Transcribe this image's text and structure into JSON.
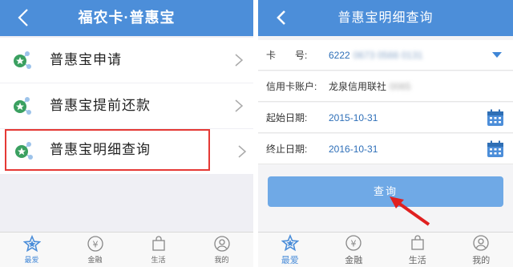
{
  "left": {
    "title": "福农卡·普惠宝",
    "menu": [
      {
        "label": "普惠宝申请"
      },
      {
        "label": "普惠宝提前还款"
      },
      {
        "label": "普惠宝明细查询"
      }
    ],
    "tabs": [
      {
        "label": "最爱",
        "icon": "star-icon"
      },
      {
        "label": "金融",
        "icon": "yen-coin-icon"
      },
      {
        "label": "生活",
        "icon": "shopping-bag-icon"
      },
      {
        "label": "我的",
        "icon": "user-icon"
      }
    ]
  },
  "right": {
    "title": "普惠宝明细查询",
    "form": {
      "card_label": "卡　　号:",
      "card_value": "6222",
      "card_masked": "0673 0566 0131",
      "account_label": "信用卡账户:",
      "account_value": "龙泉信用联社",
      "account_masked": "0065",
      "start_label": "起始日期:",
      "start_value": "2015-10-31",
      "end_label": "终止日期:",
      "end_value": "2016-10-31"
    },
    "query_label": "查询",
    "tabs": [
      {
        "label": "最爱",
        "icon": "star-icon"
      },
      {
        "label": "金融",
        "icon": "yen-coin-icon"
      },
      {
        "label": "生活",
        "icon": "shopping-bag-icon"
      },
      {
        "label": "我的",
        "icon": "user-icon"
      }
    ]
  },
  "colors": {
    "navbar": "#4c8ed9",
    "button": "#6fa9e6",
    "highlight": "#e53935",
    "value_text": "#2e6fb8"
  }
}
